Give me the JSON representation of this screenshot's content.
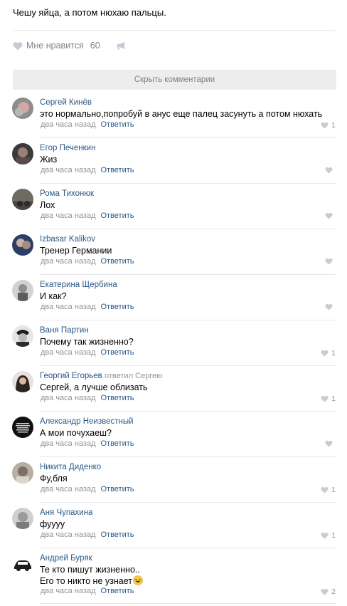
{
  "post": {
    "text": "Чешу яйца, а потом нюхаю пальцы.",
    "like_label": "Мне нравится",
    "like_count": "60"
  },
  "hide_comments_label": "Скрыть комментарии",
  "colors": {
    "link": "#2a5885",
    "meta": "#939393",
    "divider": "#e7e8ec",
    "button_bg": "#ededf0"
  },
  "comments": [
    {
      "author": "Сергей Кинёв",
      "text": "это нормально,попробуй в анус еще палец засунуть а потом нюхать",
      "time": "два часа назад",
      "reply": "Ответить",
      "likes": "1"
    },
    {
      "author": "Егор Печенкин",
      "text": "Жиз",
      "time": "два часа назад",
      "reply": "Ответить",
      "likes": ""
    },
    {
      "author": "Рома Тихонюк",
      "text": "Лох",
      "time": "два часа назад",
      "reply": "Ответить",
      "likes": ""
    },
    {
      "author": "Izbasar Kalikov",
      "text": "Тренер Германии",
      "time": "два часа назад",
      "reply": "Ответить",
      "likes": ""
    },
    {
      "author": "Екатерина Щербина",
      "text": "И как?",
      "time": "два часа назад",
      "reply": "Ответить",
      "likes": ""
    },
    {
      "author": "Ваня Партин",
      "text": "Почему так жизненно?",
      "time": "два часа назад",
      "reply": "Ответить",
      "likes": "1"
    },
    {
      "author": "Георгий Егорьев",
      "reply_to": "ответил Сергею",
      "text": "Сергей, а лучше облизать",
      "time": "два часа назад",
      "reply": "Ответить",
      "likes": "1"
    },
    {
      "author": "Александр Неизвестный",
      "text": "А мои почухаеш?",
      "time": "два часа назад",
      "reply": "Ответить",
      "likes": ""
    },
    {
      "author": "Никита Диденко",
      "text": "Фу,бля",
      "time": "два часа назад",
      "reply": "Ответить",
      "likes": "1"
    },
    {
      "author": "Аня Чупахина",
      "text": "фуууу",
      "time": "два часа назад",
      "reply": "Ответить",
      "likes": "1"
    },
    {
      "author": "Андрей Буряк",
      "text_line1": "Те кто пишут жизненно..",
      "text_line2": "Его то никто не узнает",
      "time": "два часа назад",
      "reply": "Ответить",
      "likes": "2"
    }
  ]
}
